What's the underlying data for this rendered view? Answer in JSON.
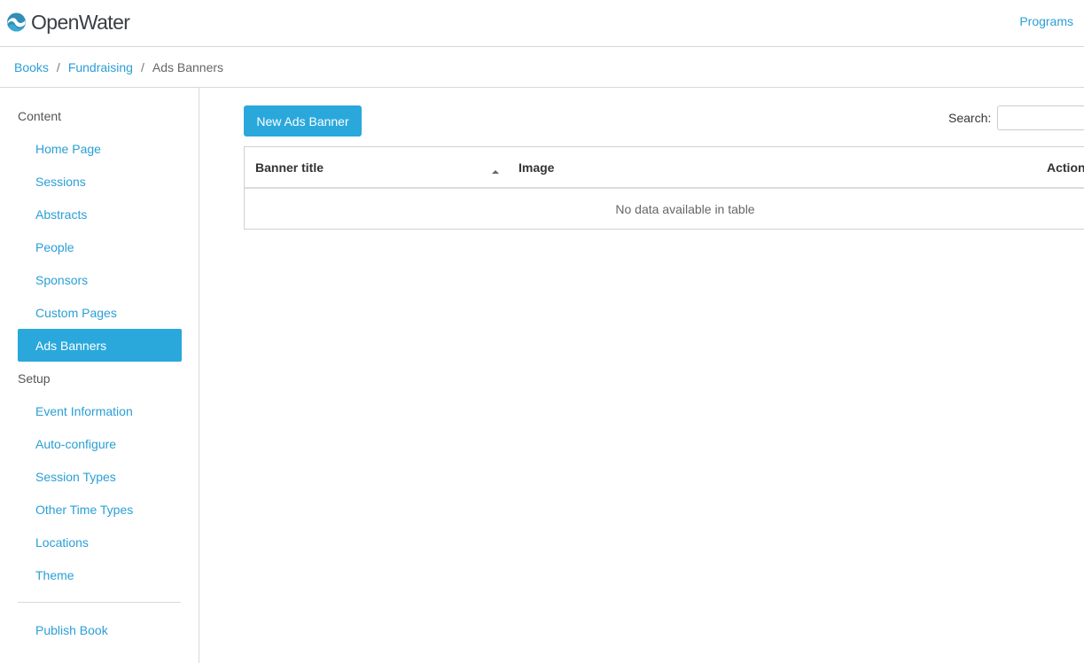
{
  "app": {
    "logo_text": "OpenWater",
    "top_link": "Programs"
  },
  "breadcrumb": {
    "items": [
      "Books",
      "Fundraising"
    ],
    "current": "Ads Banners"
  },
  "sidebar": {
    "content_heading": "Content",
    "content_items": [
      "Home Page",
      "Sessions",
      "Abstracts",
      "People",
      "Sponsors",
      "Custom Pages",
      "Ads Banners"
    ],
    "setup_heading": "Setup",
    "setup_items": [
      "Event Information",
      "Auto-configure",
      "Session Types",
      "Other Time Types",
      "Locations",
      "Theme"
    ],
    "publish": "Publish Book",
    "active_item": "Ads Banners"
  },
  "main": {
    "new_button": "New Ads Banner",
    "search_label": "Search:",
    "search_value": "",
    "table": {
      "headers": [
        "Banner title",
        "Image",
        "Action"
      ],
      "empty_message": "No data available in table"
    }
  },
  "colors": {
    "accent": "#2aa8dc",
    "link": "#2a9fd6"
  },
  "icons": {
    "logo": "openwater-wave-logo",
    "sort": "sort-asc-icon"
  }
}
